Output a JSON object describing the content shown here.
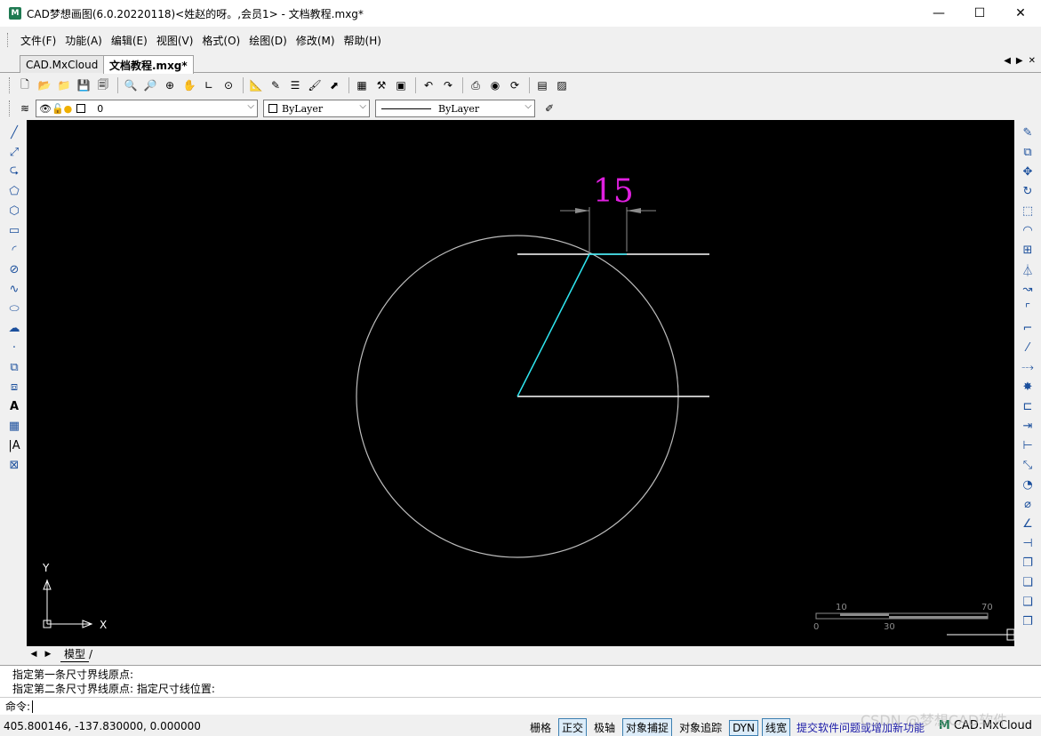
{
  "window": {
    "title": "CAD梦想画图(6.0.20220118)<姓赵的呀。,会员1> - 文档教程.mxg*",
    "minimize": "—",
    "maximize": "☐",
    "close": "✕"
  },
  "menu": [
    "文件(F)",
    "功能(A)",
    "编辑(E)",
    "视图(V)",
    "格式(O)",
    "绘图(D)",
    "修改(M)",
    "帮助(H)"
  ],
  "tabs": [
    "CAD.MxCloud",
    "文档教程.mxg*"
  ],
  "layer_toolbar": {
    "layer_value": "0",
    "color_value": "ByLayer",
    "linetype_value": "ByLayer"
  },
  "drawing": {
    "dimension_text": "15",
    "axis_y": "Y",
    "axis_x": "X",
    "scale_labels": [
      "10",
      "70",
      "0",
      "30"
    ]
  },
  "layout_tab": "模型",
  "command": {
    "history": [
      "指定第一条尺寸界线原点:",
      "指定第二条尺寸界线原点:  指定尺寸线位置:"
    ],
    "prompt": "命令:"
  },
  "status": {
    "coords": "405.800146,  -137.830000,  0.000000",
    "buttons": [
      {
        "label": "栅格",
        "on": false
      },
      {
        "label": "正交",
        "on": true
      },
      {
        "label": "极轴",
        "on": false
      },
      {
        "label": "对象捕捉",
        "on": true
      },
      {
        "label": "对象追踪",
        "on": false
      },
      {
        "label": "DYN",
        "on": true
      },
      {
        "label": "线宽",
        "on": true
      }
    ],
    "feedback": "提交软件问题或增加新功能",
    "brand": "CAD.MxCloud"
  },
  "watermark": "CSDN @梦想CAD软件",
  "colors": {
    "dimension": "#e01fe0",
    "line_white": "#ffffff",
    "line_cyan": "#2fe6f0",
    "circle": "#bdbdbd"
  }
}
